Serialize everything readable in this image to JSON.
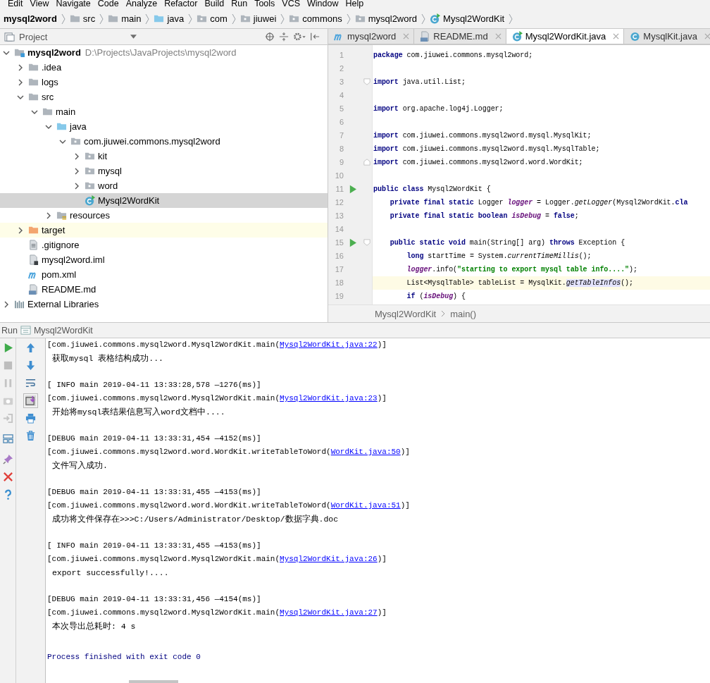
{
  "menu": [
    "Edit",
    "View",
    "Navigate",
    "Code",
    "Analyze",
    "Refactor",
    "Build",
    "Run",
    "Tools",
    "VCS",
    "Window",
    "Help"
  ],
  "breadcrumbs": [
    {
      "label": "mysql2word",
      "kind": "project"
    },
    {
      "label": "src",
      "kind": "folder"
    },
    {
      "label": "main",
      "kind": "folder"
    },
    {
      "label": "java",
      "kind": "source-folder"
    },
    {
      "label": "com",
      "kind": "package"
    },
    {
      "label": "jiuwei",
      "kind": "package"
    },
    {
      "label": "commons",
      "kind": "package"
    },
    {
      "label": "mysql2word",
      "kind": "package"
    },
    {
      "label": "Mysql2WordKit",
      "kind": "class-run"
    }
  ],
  "project_panel": {
    "title": "Project"
  },
  "project_tree": [
    {
      "label": "mysql2word",
      "path": "D:\\Projects\\JavaProjects\\mysql2word",
      "kind": "module",
      "expanded": true,
      "selected": false,
      "excluded": false,
      "children": [
        {
          "label": ".idea",
          "kind": "folder",
          "expanded": false,
          "selected": false,
          "excluded": false
        },
        {
          "label": "logs",
          "kind": "folder",
          "expanded": false,
          "selected": false,
          "excluded": false
        },
        {
          "label": "src",
          "kind": "folder",
          "expanded": true,
          "selected": false,
          "excluded": false,
          "children": [
            {
              "label": "main",
              "kind": "folder",
              "expanded": true,
              "selected": false,
              "excluded": false,
              "children": [
                {
                  "label": "java",
                  "kind": "source-folder",
                  "expanded": true,
                  "selected": false,
                  "excluded": false,
                  "children": [
                    {
                      "label": "com.jiuwei.commons.mysql2word",
                      "kind": "package",
                      "expanded": true,
                      "selected": false,
                      "excluded": false,
                      "children": [
                        {
                          "label": "kit",
                          "kind": "package",
                          "expanded": false,
                          "selected": false,
                          "excluded": false
                        },
                        {
                          "label": "mysql",
                          "kind": "package",
                          "expanded": false,
                          "selected": false,
                          "excluded": false
                        },
                        {
                          "label": "word",
                          "kind": "package",
                          "expanded": false,
                          "selected": false,
                          "excluded": false
                        },
                        {
                          "label": "Mysql2WordKit",
                          "kind": "class-run",
                          "selected": true,
                          "excluded": false
                        }
                      ]
                    }
                  ]
                },
                {
                  "label": "resources",
                  "kind": "resource-folder",
                  "expanded": false,
                  "selected": false,
                  "excluded": false
                }
              ]
            }
          ]
        },
        {
          "label": "target",
          "kind": "excluded-folder",
          "expanded": false,
          "selected": false,
          "excluded": true
        },
        {
          "label": ".gitignore",
          "kind": "text-file",
          "selected": false,
          "excluded": false
        },
        {
          "label": "mysql2word.iml",
          "kind": "iml-file",
          "selected": false,
          "excluded": false
        },
        {
          "label": "pom.xml",
          "kind": "maven",
          "selected": false,
          "excluded": false
        },
        {
          "label": "README.md",
          "kind": "markdown",
          "selected": false,
          "excluded": false
        }
      ]
    },
    {
      "label": "External Libraries",
      "kind": "libraries",
      "expanded": false,
      "selected": false,
      "excluded": false
    }
  ],
  "editor_tabs": [
    {
      "label": "mysql2word",
      "kind": "maven",
      "selected": false
    },
    {
      "label": "README.md",
      "kind": "markdown",
      "selected": false
    },
    {
      "label": "Mysql2WordKit.java",
      "kind": "class-run",
      "selected": true
    },
    {
      "label": "MysqlKit.java",
      "kind": "class",
      "selected": false
    }
  ],
  "code_lines": [
    {
      "number": "1",
      "current": false,
      "runnable": false,
      "tokens": [
        {
          "kind": "kw",
          "text": "package"
        },
        {
          "kind": "plain",
          "text": " com.jiuwei.commons.mysql2word;"
        }
      ]
    },
    {
      "number": "2",
      "current": false,
      "runnable": false
    },
    {
      "number": "3",
      "current": false,
      "runnable": false,
      "kind": "fold-start",
      "tokens": [
        {
          "kind": "kw",
          "text": "import"
        },
        {
          "kind": "plain",
          "text": " java.util.List;"
        }
      ]
    },
    {
      "number": "4",
      "current": false,
      "runnable": false
    },
    {
      "number": "5",
      "current": false,
      "runnable": false,
      "tokens": [
        {
          "kind": "kw",
          "text": "import"
        },
        {
          "kind": "plain",
          "text": " org.apache.log4j.Logger;"
        }
      ]
    },
    {
      "number": "6",
      "current": false,
      "runnable": false
    },
    {
      "number": "7",
      "current": false,
      "runnable": false,
      "tokens": [
        {
          "kind": "kw",
          "text": "import"
        },
        {
          "kind": "plain",
          "text": " com.jiuwei.commons.mysql2word.mysql.MysqlKit;"
        }
      ]
    },
    {
      "number": "8",
      "current": false,
      "runnable": false,
      "tokens": [
        {
          "kind": "kw",
          "text": "import"
        },
        {
          "kind": "plain",
          "text": " com.jiuwei.commons.mysql2word.mysql.MysqlTable;"
        }
      ]
    },
    {
      "number": "9",
      "current": false,
      "runnable": false,
      "kind": "fold-end",
      "tokens": [
        {
          "kind": "kw",
          "text": "import"
        },
        {
          "kind": "plain",
          "text": " com.jiuwei.commons.mysql2word.word.WordKit;"
        }
      ]
    },
    {
      "number": "10",
      "current": false,
      "runnable": false
    },
    {
      "number": "11",
      "current": false,
      "runnable": true,
      "tokens": [
        {
          "kind": "kw",
          "text": "public class"
        },
        {
          "kind": "plain",
          "text": " Mysql2WordKit {"
        }
      ]
    },
    {
      "number": "12",
      "current": false,
      "runnable": false,
      "tokens": [
        {
          "kind": "kw",
          "text": "    private final static"
        },
        {
          "kind": "plain",
          "text": " Logger "
        },
        {
          "kind": "field",
          "text": "logger"
        },
        {
          "kind": "plain",
          "text": " = Logger."
        },
        {
          "kind": "static",
          "text": "getLogger"
        },
        {
          "kind": "plain",
          "text": "(Mysql2WordKit."
        },
        {
          "kind": "kw",
          "text": "cla"
        }
      ]
    },
    {
      "number": "13",
      "current": false,
      "runnable": false,
      "tokens": [
        {
          "kind": "kw",
          "text": "    private final static boolean "
        },
        {
          "kind": "field",
          "text": "isDebug"
        },
        {
          "kind": "plain",
          "text": " = "
        },
        {
          "kind": "kw",
          "text": "false"
        },
        {
          "kind": "plain",
          "text": ";"
        }
      ]
    },
    {
      "number": "14",
      "current": false,
      "runnable": false
    },
    {
      "number": "15",
      "current": false,
      "runnable": true,
      "kind": "fold-start",
      "tokens": [
        {
          "kind": "kw",
          "text": "    public static void"
        },
        {
          "kind": "plain",
          "text": " main(String[] arg) "
        },
        {
          "kind": "kw",
          "text": "throws"
        },
        {
          "kind": "plain",
          "text": " Exception {"
        }
      ]
    },
    {
      "number": "16",
      "current": false,
      "runnable": false,
      "tokens": [
        {
          "kind": "kw",
          "text": "        long"
        },
        {
          "kind": "plain",
          "text": " startTime = System."
        },
        {
          "kind": "static",
          "text": "currentTimeMillis"
        },
        {
          "kind": "plain",
          "text": "();"
        }
      ]
    },
    {
      "number": "17",
      "current": false,
      "runnable": false,
      "tokens": [
        {
          "kind": "field",
          "text": "        logger"
        },
        {
          "kind": "plain",
          "text": ".info("
        },
        {
          "kind": "string",
          "text": "\"starting to export mysql table info....\""
        },
        {
          "kind": "plain",
          "text": ");"
        }
      ]
    },
    {
      "number": "18",
      "current": true,
      "runnable": false,
      "tokens": [
        {
          "kind": "plain",
          "text": "        List<MysqlTable> tableList = MysqlKit."
        },
        {
          "kind": "highlight",
          "text": "getTableInfos"
        },
        {
          "kind": "plain",
          "text": "();"
        }
      ]
    },
    {
      "number": "19",
      "current": false,
      "runnable": false,
      "tokens": [
        {
          "kind": "kw",
          "text": "        if"
        },
        {
          "kind": "plain",
          "text": " ("
        },
        {
          "kind": "field",
          "text": "isDebug"
        },
        {
          "kind": "plain",
          "text": ") {"
        }
      ]
    }
  ],
  "editor_breadcrumbs": [
    "Mysql2WordKit",
    "main()"
  ],
  "run_panel": {
    "label": "Run",
    "config": "Mysql2WordKit",
    "scroll_to_end_on": true
  },
  "console_blocks": [
    [
      {
        "kind": "link",
        "before": "[com.jiuwei.commons.mysql2word.Mysql2WordKit.main(",
        "link": "Mysql2WordKit.java:22",
        "after": ")]"
      },
      {
        "kind": "message",
        "text": " 获取mysql 表格结构成功..."
      }
    ],
    [
      {
        "kind": "log",
        "text": "[ INFO main 2019-04-11 13:33:28,578 —1276(ms)]"
      },
      {
        "kind": "link",
        "before": "[com.jiuwei.commons.mysql2word.Mysql2WordKit.main(",
        "link": "Mysql2WordKit.java:23",
        "after": ")]"
      },
      {
        "kind": "message",
        "text": " 开始将mysql表结果信息写入word文档中...."
      }
    ],
    [
      {
        "kind": "log",
        "text": "[DEBUG main 2019-04-11 13:33:31,454 —4152(ms)]"
      },
      {
        "kind": "link",
        "before": "[com.jiuwei.commons.mysql2word.word.WordKit.writeTableToWord(",
        "link": "WordKit.java:50",
        "after": ")]"
      },
      {
        "kind": "message",
        "text": " 文件写入成功."
      }
    ],
    [
      {
        "kind": "log",
        "text": "[DEBUG main 2019-04-11 13:33:31,455 —4153(ms)]"
      },
      {
        "kind": "link",
        "before": "[com.jiuwei.commons.mysql2word.word.WordKit.writeTableToWord(",
        "link": "WordKit.java:51",
        "after": ")]"
      },
      {
        "kind": "message",
        "text": " 成功将文件保存在>>>C:/Users/Administrator/Desktop/数据字典.doc"
      }
    ],
    [
      {
        "kind": "log",
        "text": "[ INFO main 2019-04-11 13:33:31,455 —4153(ms)]"
      },
      {
        "kind": "link",
        "before": "[com.jiuwei.commons.mysql2word.Mysql2WordKit.main(",
        "link": "Mysql2WordKit.java:26",
        "after": ")]"
      },
      {
        "kind": "message",
        "text": " export successfully!...."
      }
    ],
    [
      {
        "kind": "log",
        "text": "[DEBUG main 2019-04-11 13:33:31,456 —4154(ms)]"
      },
      {
        "kind": "link",
        "before": "[com.jiuwei.commons.mysql2word.Mysql2WordKit.main(",
        "link": "Mysql2WordKit.java:27",
        "after": ")]"
      },
      {
        "kind": "message",
        "text": " 本次导出总耗时: 4 s"
      }
    ]
  ],
  "exit_message": "Process finished with exit code 0"
}
